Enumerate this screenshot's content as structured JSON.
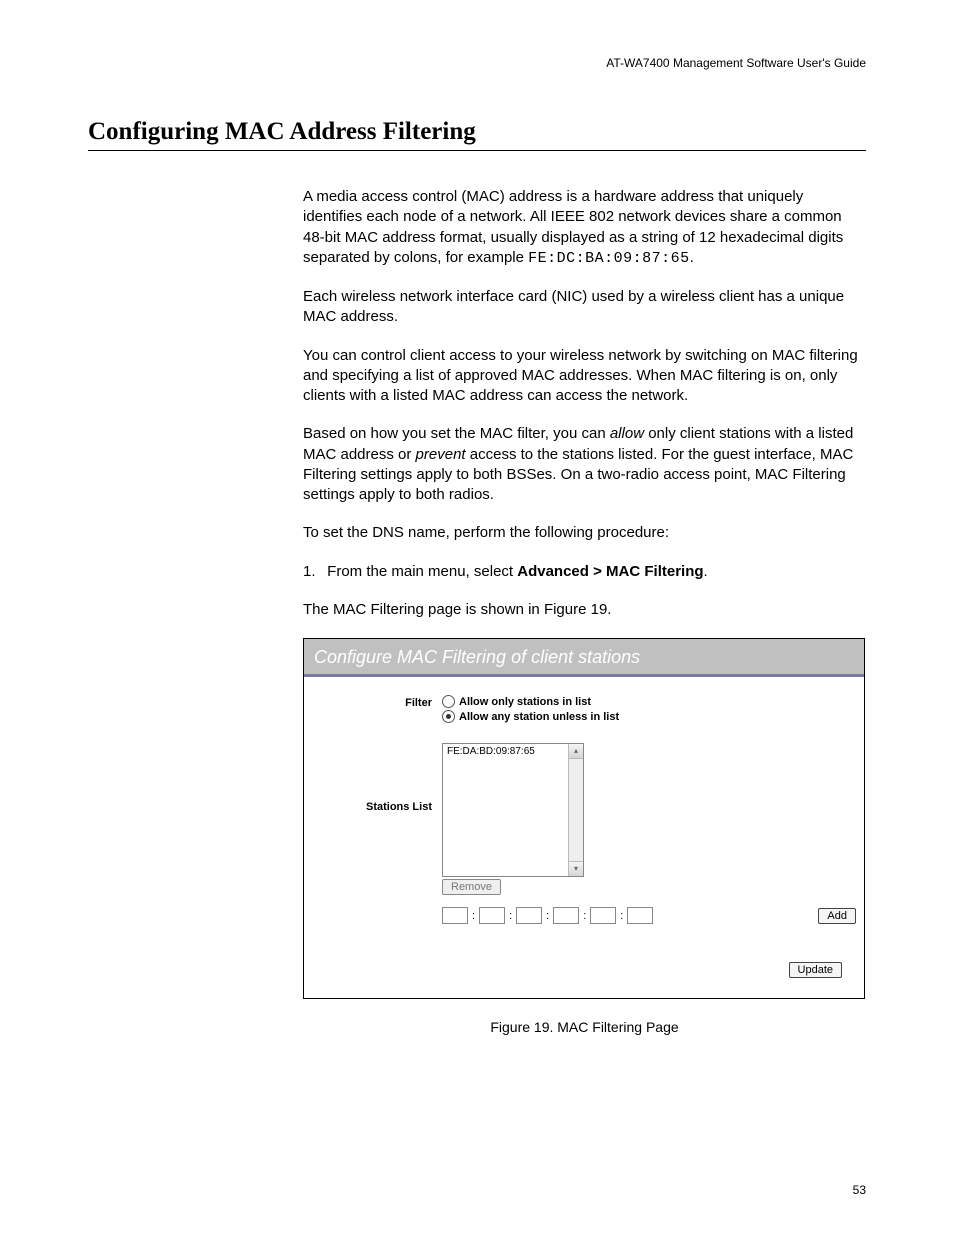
{
  "header": {
    "guide_title": "AT-WA7400 Management Software User's Guide"
  },
  "section": {
    "title": "Configuring MAC Address Filtering"
  },
  "paragraphs": {
    "p1_a": "A media access control (",
    "p1_mac": "MAC",
    "p1_b": ") address is a hardware address that uniquely identifies each node of a network. All IEEE 802 network devices share a common 48-bit MAC address format, usually displayed as a string of 12 hexadecimal digits separated by colons, for example ",
    "p1_code": "FE:DC:BA:09:87:65",
    "p1_c": ".",
    "p2_a": "Each wireless network interface card (",
    "p2_nic": "NIC",
    "p2_b": ") used by a wireless client has a unique MAC address.",
    "p3": "You can control client access to your wireless network by switching on MAC filtering and specifying a list of approved MAC addresses. When MAC filtering is on, only clients with a listed MAC address can access the network.",
    "p4_a": "Based on how you set the MAC filter, you can ",
    "p4_allow": "allow",
    "p4_b": " only client stations with a listed MAC address or ",
    "p4_prevent": "prevent",
    "p4_c": " access to the stations listed. For the guest interface, ",
    "p4_mac": "MAC",
    "p4_d": " Filtering settings apply to both ",
    "p4_bss": "BSS",
    "p4_e": "es. On a two-radio access point, MAC Filtering settings apply to both radios.",
    "p5": "To set the DNS name, perform the following procedure:",
    "step1_num": "1.",
    "step1_a": "From the main menu, select ",
    "step1_bold": "Advanced > MAC Filtering",
    "step1_b": ".",
    "step1_sub": "The MAC Filtering page is shown in Figure 19."
  },
  "figure": {
    "title": "Configure MAC Filtering of client stations",
    "labels": {
      "filter": "Filter",
      "stations": "Stations List"
    },
    "radio": {
      "opt1": "Allow only stations in list",
      "opt2": "Allow any station unless in list",
      "selected": "opt2"
    },
    "list_entry": "FE:DA:BD:09:87:65",
    "buttons": {
      "remove": "Remove",
      "add": "Add",
      "update": "Update"
    },
    "mac_sep": ":",
    "caption": "Figure 19. MAC Filtering Page"
  },
  "page_number": "53"
}
